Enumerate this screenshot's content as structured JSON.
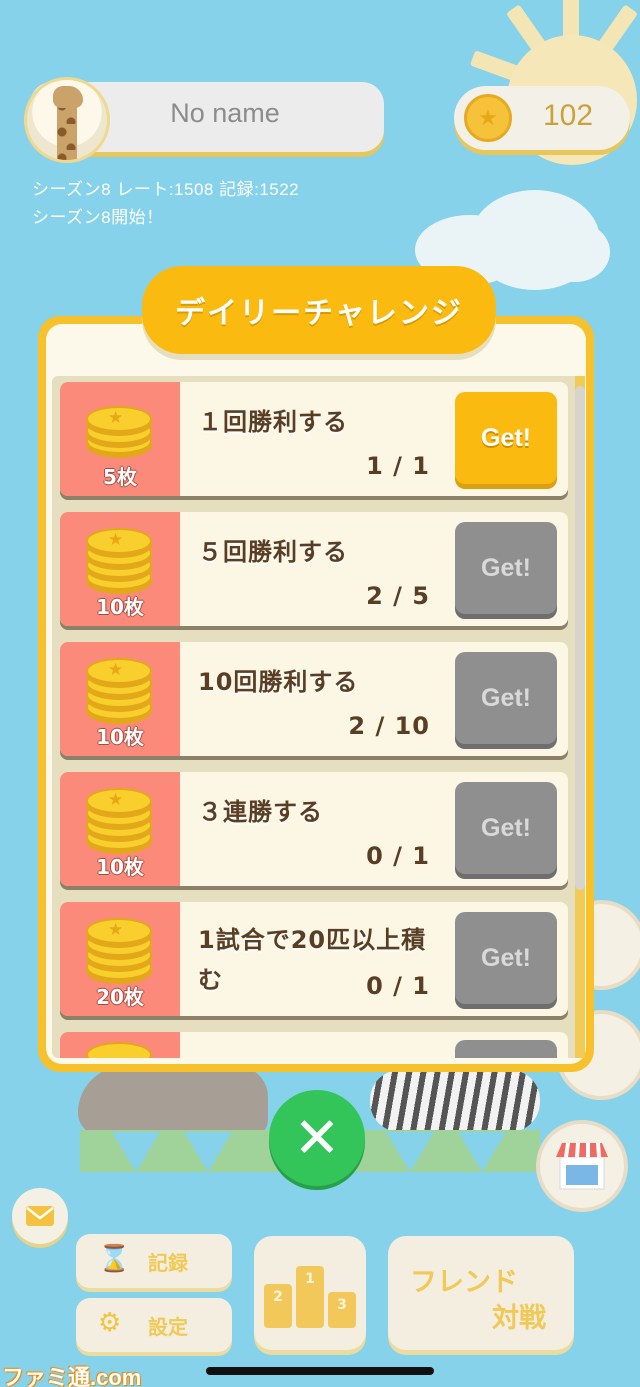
{
  "header": {
    "player_name": "No name",
    "coins": "102",
    "season_info": "シーズン8  レート:1508 記録:1522",
    "season_notice": "シーズン8開始！"
  },
  "daily": {
    "title": "デイリーチャレンジ",
    "items": [
      {
        "reward": "5枚",
        "task": "１回勝利する",
        "progress": "1 / 1",
        "button": "Get!",
        "state": "active"
      },
      {
        "reward": "10枚",
        "task": "５回勝利する",
        "progress": "2 / 5",
        "button": "Get!",
        "state": "disabled"
      },
      {
        "reward": "10枚",
        "task": "10回勝利する",
        "progress": "2 / 10",
        "button": "Get!",
        "state": "disabled"
      },
      {
        "reward": "10枚",
        "task": "３連勝する",
        "progress": "0 / 1",
        "button": "Get!",
        "state": "disabled"
      },
      {
        "reward": "20枚",
        "task": "1試合で20匹以上積む",
        "progress": "0 / 1",
        "button": "Get!",
        "state": "disabled"
      }
    ]
  },
  "close_symbol": "✕",
  "bottom": {
    "records_label": "記録",
    "settings_label": "設定",
    "ranking_podium": [
      "2",
      "1",
      "3"
    ],
    "friend_line1": "フレンド",
    "friend_line2": "対戦"
  },
  "watermark": "ファミ通.com",
  "icons": {
    "coin": "coin-icon",
    "mail": "mail-icon",
    "hourglass": "hourglass-icon",
    "gear": "gear-icon",
    "close": "close-icon",
    "podium": "podium-icon"
  },
  "colors": {
    "background": "#86d2ea",
    "accent_yellow": "#fbba10",
    "reward_red": "#fb8a7a",
    "get_disabled": "#8f8f8f",
    "close_green": "#33c45a"
  }
}
